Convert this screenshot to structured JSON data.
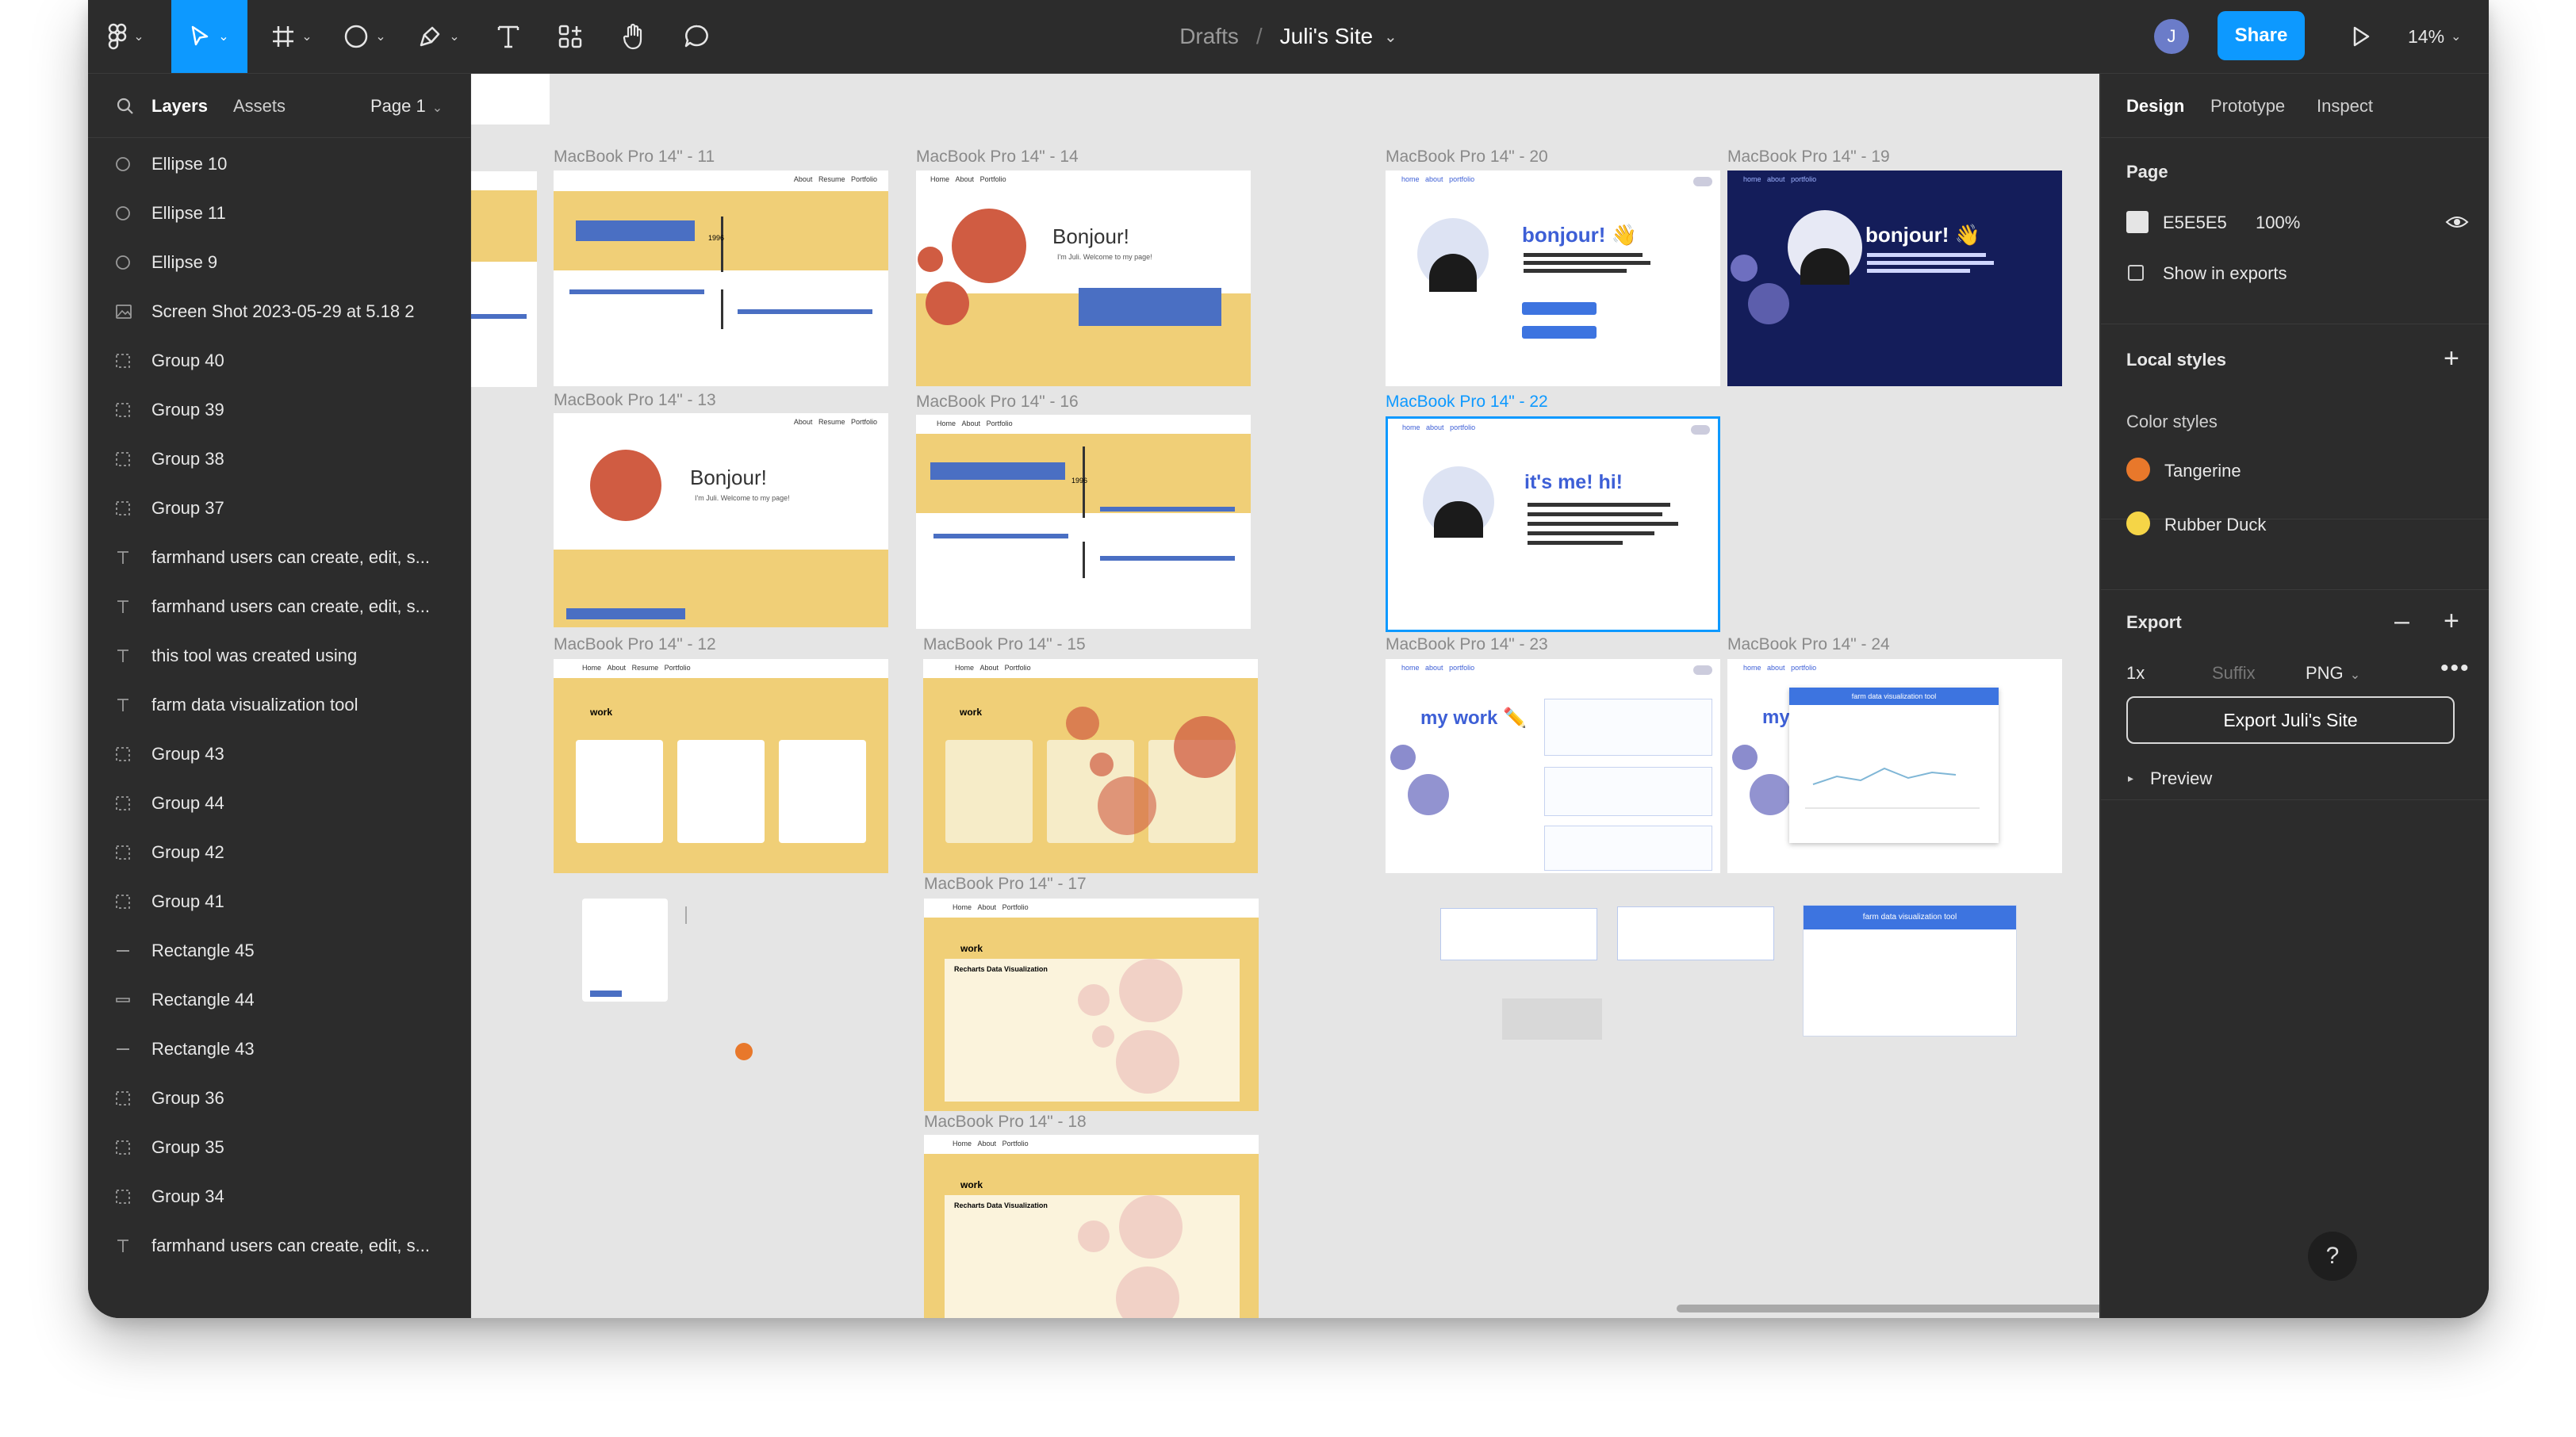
{
  "toolbar": {
    "breadcrumb_drafts": "Drafts",
    "breadcrumb_sep": "/",
    "file_name": "Juli's Site",
    "avatar_initial": "J",
    "share_label": "Share",
    "zoom_label": "14%"
  },
  "left_panel": {
    "tab_layers": "Layers",
    "tab_assets": "Assets",
    "page_selector": "Page 1",
    "layers": [
      {
        "icon": "ellipse-icon",
        "name": "Ellipse 10"
      },
      {
        "icon": "ellipse-icon",
        "name": "Ellipse 11"
      },
      {
        "icon": "ellipse-icon",
        "name": "Ellipse 9"
      },
      {
        "icon": "image-icon",
        "name": "Screen Shot 2023-05-29 at 5.18 2"
      },
      {
        "icon": "group-icon",
        "name": "Group 40"
      },
      {
        "icon": "group-icon",
        "name": "Group 39"
      },
      {
        "icon": "group-icon",
        "name": "Group 38"
      },
      {
        "icon": "group-icon",
        "name": "Group 37"
      },
      {
        "icon": "text-icon",
        "name": "farmhand users can create, edit, s..."
      },
      {
        "icon": "text-icon",
        "name": "farmhand users can create, edit, s..."
      },
      {
        "icon": "text-icon",
        "name": "this tool was created using"
      },
      {
        "icon": "text-icon",
        "name": "farm data visualization tool"
      },
      {
        "icon": "group-icon",
        "name": "Group 43"
      },
      {
        "icon": "group-icon",
        "name": "Group 44"
      },
      {
        "icon": "group-icon",
        "name": "Group 42"
      },
      {
        "icon": "group-icon",
        "name": "Group 41"
      },
      {
        "icon": "line-icon",
        "name": "Rectangle 45"
      },
      {
        "icon": "rectangle-icon",
        "name": "Rectangle 44"
      },
      {
        "icon": "line-icon",
        "name": "Rectangle 43"
      },
      {
        "icon": "group-icon",
        "name": "Group 36"
      },
      {
        "icon": "group-icon",
        "name": "Group 35"
      },
      {
        "icon": "group-icon",
        "name": "Group 34"
      },
      {
        "icon": "text-icon",
        "name": "farmhand users can create, edit, s..."
      }
    ]
  },
  "canvas": {
    "frames": {
      "f11": "MacBook Pro 14\" - 11",
      "f14": "MacBook Pro 14\" - 14",
      "f20": "MacBook Pro 14\" - 20",
      "f19": "MacBook Pro 14\" - 19",
      "f13": "MacBook Pro 14\" - 13",
      "f16": "MacBook Pro 14\" - 16",
      "f22": "MacBook Pro 14\" - 22",
      "f12": "MacBook Pro 14\" - 12",
      "f15": "MacBook Pro 14\" - 15",
      "f23": "MacBook Pro 14\" - 23",
      "f24": "MacBook Pro 14\" - 24",
      "f17": "MacBook Pro 14\" - 17",
      "f18": "MacBook Pro 14\" - 18"
    },
    "texts": {
      "bonjour": "Bonjour!",
      "welcome": "I'm Juli. Welcome to my page!",
      "bonjour_wave": "bonjour! 👋",
      "its_me": "it's me! hi!",
      "my_work": "my work ✏️",
      "work": "work",
      "recharts": "Recharts Data Visualization",
      "farm_tool": "farm data visualization tool",
      "year": "1996",
      "nav_home": "Home",
      "nav_about": "About",
      "nav_resume": "Resume",
      "nav_portfolio": "Portfolio",
      "nav_home_lc": "home",
      "nav_about_lc": "about",
      "nav_portfolio_lc": "portfolio"
    }
  },
  "right_panel": {
    "tab_design": "Design",
    "tab_prototype": "Prototype",
    "tab_inspect": "Inspect",
    "page_heading": "Page",
    "page_color": "E5E5E5",
    "page_opacity": "100%",
    "show_in_exports": "Show in exports",
    "local_styles": "Local styles",
    "color_styles": "Color styles",
    "styles": [
      {
        "name": "Tangerine",
        "color": "#e8782b"
      },
      {
        "name": "Rubber Duck",
        "color": "#f5d547"
      }
    ],
    "export_heading": "Export",
    "export_scale": "1x",
    "export_suffix_placeholder": "Suffix",
    "export_format": "PNG",
    "export_button": "Export Juli's Site",
    "preview": "Preview"
  },
  "help_label": "?",
  "colors": {
    "accent": "#0d99ff",
    "panel": "#2c2c2c",
    "canvas": "#e5e5e5",
    "yellow": "#f0cf77",
    "tangerine": "#d05c42",
    "navy": "#141d5a"
  }
}
